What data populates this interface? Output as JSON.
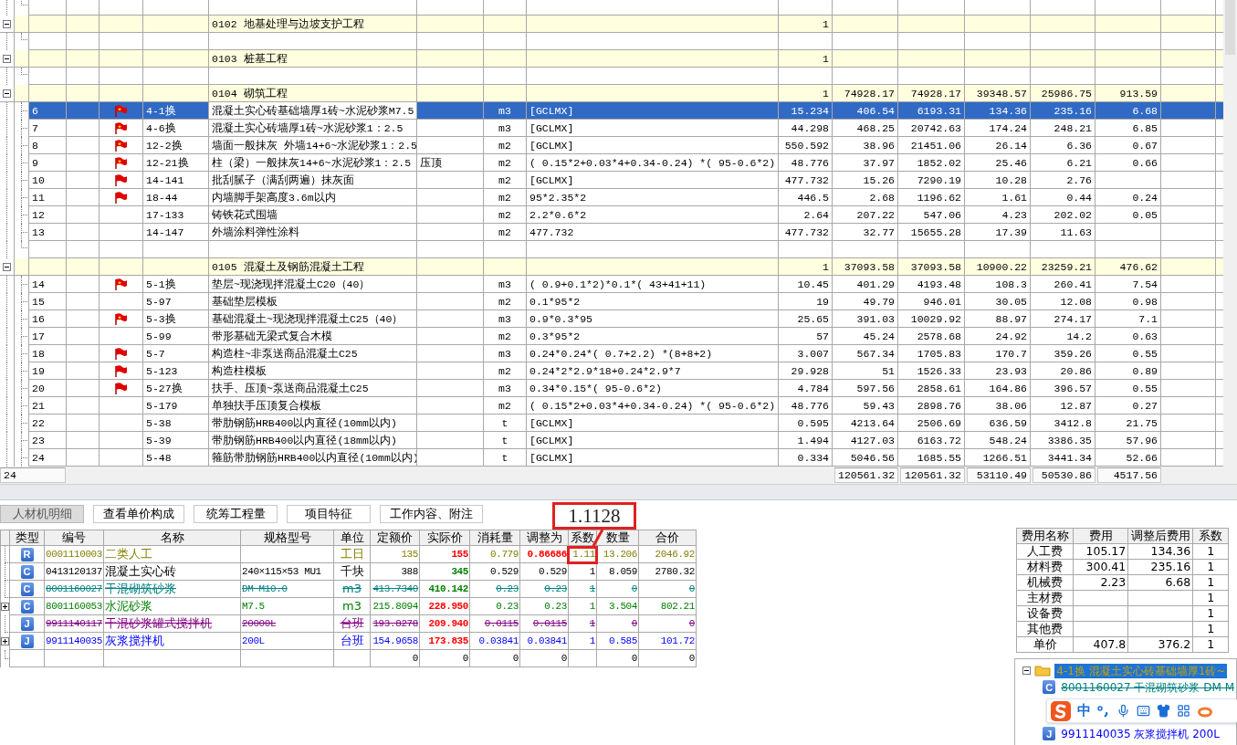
{
  "top_table": {
    "rows": [
      {
        "kind": "blank"
      },
      {
        "kind": "group",
        "expanded": true,
        "title": "0102 地基处理与边坡支护工程",
        "qty": "1"
      },
      {
        "kind": "blank"
      },
      {
        "kind": "group",
        "expanded": true,
        "title": "0103 桩基工程",
        "qty": "1"
      },
      {
        "kind": "blank"
      },
      {
        "kind": "group",
        "expanded": true,
        "title": "0104 砌筑工程",
        "qty": "1",
        "values": [
          "74928.17",
          "74928.17",
          "39348.57",
          "25986.75",
          "913.59"
        ]
      },
      {
        "kind": "item",
        "selected": true,
        "seq": "6",
        "flagged": true,
        "starred": true,
        "code": "4-1换",
        "name": "混凝土实心砖基础墙厚1砖~水泥砂浆M7.5",
        "unit": "m3",
        "formula": "[GCLMX]",
        "qty": "15.234",
        "values": [
          "406.54",
          "6193.31",
          "134.36",
          "235.16",
          "6.68"
        ]
      },
      {
        "kind": "item",
        "selected": false,
        "seq": "7",
        "flagged": true,
        "starred": true,
        "code": "4-6换",
        "name": "混凝土实心砖墙厚1砖~水泥砂浆1：2.5",
        "unit": "m3",
        "formula": "[GCLMX]",
        "qty": "44.298",
        "values": [
          "468.25",
          "20742.63",
          "174.24",
          "248.21",
          "6.85"
        ]
      },
      {
        "kind": "item",
        "selected": false,
        "seq": "8",
        "flagged": true,
        "starred": true,
        "code": "12-2换",
        "name": "墙面一般抹灰 外墙14+6~水泥砂浆1：2.5",
        "unit": "m2",
        "formula": "[GCLMX]",
        "qty": "550.592",
        "values": [
          "38.96",
          "21451.06",
          "26.14",
          "6.36",
          "0.67"
        ]
      },
      {
        "kind": "item",
        "selected": false,
        "seq": "9",
        "flagged": true,
        "starred": true,
        "code": "12-21换",
        "name": "柱（梁）一般抹灰14+6~水泥砂浆1：2.5",
        "note": "压顶",
        "unit": "m2",
        "formula": "( 0.15*2+0.03*4+0.34-0.24) *( 95-0.6*2)",
        "qty": "48.776",
        "values": [
          "37.97",
          "1852.02",
          "25.46",
          "6.21",
          "0.66"
        ]
      },
      {
        "kind": "item",
        "selected": false,
        "seq": "10",
        "flagged": true,
        "starred": false,
        "code": "14-141",
        "name": "批刮腻子（满刮两遍）抹灰面",
        "unit": "m2",
        "formula": "[GCLMX]",
        "qty": "477.732",
        "values": [
          "15.26",
          "7290.19",
          "10.28",
          "2.76"
        ]
      },
      {
        "kind": "item",
        "selected": false,
        "seq": "11",
        "flagged": true,
        "starred": false,
        "code": "18-44",
        "name": "内墙脚手架高度3.6m以内",
        "unit": "m2",
        "formula": "95*2.35*2",
        "qty": "446.5",
        "values": [
          "2.68",
          "1196.62",
          "1.61",
          "0.44",
          "0.24"
        ]
      },
      {
        "kind": "item",
        "selected": false,
        "seq": "12",
        "flagged": false,
        "code": "17-133",
        "name": "铸铁花式围墙",
        "unit": "m2",
        "formula": "2.2*0.6*2",
        "qty": "2.64",
        "values": [
          "207.22",
          "547.06",
          "4.23",
          "202.02",
          "0.05"
        ]
      },
      {
        "kind": "item",
        "selected": false,
        "seq": "13",
        "flagged": false,
        "code": "14-147",
        "name": "外墙涂料弹性涂料",
        "unit": "m2",
        "formula": "477.732",
        "qty": "477.732",
        "values": [
          "32.77",
          "15655.28",
          "17.39",
          "11.63"
        ]
      },
      {
        "kind": "blank"
      },
      {
        "kind": "group",
        "expanded": true,
        "title": "0105 混凝土及钢筋混凝土工程",
        "qty": "1",
        "values": [
          "37093.58",
          "37093.58",
          "10900.22",
          "23259.21",
          "476.62"
        ]
      },
      {
        "kind": "item",
        "selected": false,
        "seq": "14",
        "flagged": true,
        "starred": true,
        "code": "5-1换",
        "name": "垫层~现浇现拌混凝土C20（40）",
        "unit": "m3",
        "formula": "( 0.9+0.1*2)*0.1*( 43+41+11)",
        "qty": "10.45",
        "values": [
          "401.29",
          "4193.48",
          "108.3",
          "260.41",
          "7.54"
        ]
      },
      {
        "kind": "item",
        "selected": false,
        "seq": "15",
        "flagged": false,
        "code": "5-97",
        "name": "基础垫层模板",
        "unit": "m2",
        "formula": "0.1*95*2",
        "qty": "19",
        "values": [
          "49.79",
          "946.01",
          "30.05",
          "12.08",
          "0.98"
        ]
      },
      {
        "kind": "item",
        "selected": false,
        "seq": "16",
        "flagged": true,
        "starred": true,
        "code": "5-3换",
        "name": "基础混凝土~现浇现拌混凝土C25（40）",
        "unit": "m3",
        "formula": "0.9*0.3*95",
        "qty": "25.65",
        "values": [
          "391.03",
          "10029.92",
          "88.97",
          "274.17",
          "7.1"
        ]
      },
      {
        "kind": "item",
        "selected": false,
        "seq": "17",
        "flagged": false,
        "code": "5-99",
        "name": "带形基础无梁式复合木模",
        "unit": "m2",
        "formula": "0.3*95*2",
        "qty": "57",
        "values": [
          "45.24",
          "2578.68",
          "24.92",
          "14.2",
          "0.63"
        ]
      },
      {
        "kind": "item",
        "selected": false,
        "seq": "18",
        "flagged": true,
        "starred": false,
        "code": "5-7",
        "name": "构造柱~非泵送商品混凝土C25",
        "unit": "m3",
        "formula": "0.24*0.24*( 0.7+2.2) *(8+8+2)",
        "qty": "3.007",
        "values": [
          "567.34",
          "1705.83",
          "170.7",
          "359.26",
          "0.55"
        ]
      },
      {
        "kind": "item",
        "selected": false,
        "seq": "19",
        "flagged": true,
        "starred": false,
        "code": "5-123",
        "name": "构造柱模板",
        "unit": "m2",
        "formula": "0.24*2*2.9*18+0.24*2.9*7",
        "qty": "29.928",
        "values": [
          "51",
          "1526.33",
          "23.93",
          "20.86",
          "0.89"
        ]
      },
      {
        "kind": "item",
        "selected": false,
        "seq": "20",
        "flagged": true,
        "starred": false,
        "code": "5-27换",
        "name": "扶手、压顶~泵送商品混凝土C25",
        "unit": "m3",
        "formula": "0.34*0.15*( 95-0.6*2)",
        "qty": "4.784",
        "values": [
          "597.56",
          "2858.61",
          "164.86",
          "396.57",
          "0.55"
        ]
      },
      {
        "kind": "item",
        "selected": false,
        "seq": "21",
        "flagged": false,
        "code": "5-179",
        "name": "单独扶手压顶复合模板",
        "unit": "m2",
        "formula": "( 0.15*2+0.03*4+0.34-0.24) *( 95-0.6*2)",
        "qty": "48.776",
        "values": [
          "59.43",
          "2898.76",
          "38.06",
          "12.87",
          "0.27"
        ]
      },
      {
        "kind": "item",
        "selected": false,
        "seq": "22",
        "flagged": false,
        "code": "5-38",
        "name": "带肋钢筋HRB400以内直径(10mm以内)",
        "unit": "t",
        "formula": "[GCLMX]",
        "qty": "0.595",
        "values": [
          "4213.64",
          "2506.69",
          "636.59",
          "3412.8",
          "21.75"
        ]
      },
      {
        "kind": "item",
        "selected": false,
        "seq": "23",
        "flagged": false,
        "code": "5-39",
        "name": "带肋钢筋HRB400以内直径(18mm以内)",
        "unit": "t",
        "formula": "[GCLMX]",
        "qty": "1.494",
        "values": [
          "4127.03",
          "6163.72",
          "548.24",
          "3386.35",
          "57.96"
        ]
      },
      {
        "kind": "item",
        "selected": false,
        "seq": "24",
        "flagged": false,
        "code": "5-48",
        "name": "箍筋带肋钢筋HRB400以内直径(10mm以内)",
        "unit": "t",
        "formula": "[GCLMX]",
        "qty": "0.334",
        "values": [
          "5046.56",
          "1685.55",
          "1266.51",
          "3441.34",
          "52.66"
        ]
      }
    ],
    "footer": {
      "count": "24",
      "totals": [
        "120561.32",
        "120561.32",
        "53110.49",
        "50530.86",
        "4517.56"
      ]
    }
  },
  "bottom_tabs": [
    {
      "label": "人材机明细",
      "selected": true
    },
    {
      "label": "查看单价构成",
      "selected": false
    },
    {
      "label": "统筹工程量",
      "selected": false
    },
    {
      "label": "项目特征",
      "selected": false
    },
    {
      "label": "工作内容、附注",
      "selected": false
    }
  ],
  "callout": {
    "value": "1.1128"
  },
  "resource_grid": {
    "columns": [
      "类型",
      "编号",
      "名称",
      "规格型号",
      "单位",
      "定额价",
      "实际价",
      "消耗量",
      "调整为",
      "系数",
      "数量",
      "合价"
    ],
    "rows": [
      {
        "kind": "resource",
        "type": "R",
        "expandable": false,
        "color": "#808000",
        "struck": false,
        "price_up": true,
        "adjusted_highlight": true,
        "code": "0001110003",
        "name": "二类人工",
        "unit": "工日",
        "quota_price": "135",
        "actual_price": "155",
        "consumption": "0.779",
        "adjusted": "0.86686",
        "coefficient": "1.11",
        "quantity": "13.206",
        "total": "2046.92"
      },
      {
        "kind": "resource",
        "type": "C",
        "expandable": false,
        "color": "#000000",
        "struck": false,
        "price_up": false,
        "adjusted_highlight": false,
        "code": "0413120137",
        "name": "混凝土实心砖",
        "spec": "240×115×53 MU1",
        "unit": "千块",
        "quota_price": "388",
        "actual_price": "345",
        "consumption": "0.529",
        "adjusted": "0.529",
        "coefficient": "1",
        "quantity": "8.059",
        "total": "2780.32"
      },
      {
        "kind": "resource",
        "type": "C",
        "expandable": false,
        "color": "#008080",
        "struck": true,
        "price_up": false,
        "adjusted_highlight": false,
        "code": "8001160027",
        "name": "干混砌筑砂浆",
        "spec": "DM M10.0",
        "unit": "m3",
        "quota_price": "413.7340",
        "actual_price": "410.142",
        "consumption": "0.23",
        "adjusted": "0.23",
        "coefficient": "1",
        "quantity": "0",
        "total": "0"
      },
      {
        "kind": "resource",
        "type": "C",
        "expandable": true,
        "color": "#008000",
        "struck": false,
        "price_up": true,
        "adjusted_highlight": false,
        "code": "8001160053",
        "name": "水泥砂浆",
        "spec": "M7.5",
        "unit": "m3",
        "quota_price": "215.8094",
        "actual_price": "228.950",
        "consumption": "0.23",
        "adjusted": "0.23",
        "coefficient": "1",
        "quantity": "3.504",
        "total": "802.21"
      },
      {
        "kind": "resource",
        "type": "J",
        "expandable": false,
        "color": "#800080",
        "struck": true,
        "price_up": true,
        "adjusted_highlight": false,
        "code": "9911140117",
        "name": "干混砂浆罐式搅拌机",
        "spec": "20000L",
        "unit": "台班",
        "quota_price": "193.8278",
        "actual_price": "209.940",
        "consumption": "0.0115",
        "adjusted": "0.0115",
        "coefficient": "1",
        "quantity": "0",
        "total": "0"
      },
      {
        "kind": "resource",
        "type": "J",
        "expandable": true,
        "color": "#0000ff",
        "struck": false,
        "price_up": true,
        "adjusted_highlight": false,
        "code": "9911140035",
        "name": "灰浆搅拌机",
        "spec": "200L",
        "unit": "台班",
        "quota_price": "154.9658",
        "actual_price": "173.835",
        "consumption": "0.03841",
        "adjusted": "0.03841",
        "coefficient": "1",
        "quantity": "0.585",
        "total": "101.72"
      },
      {
        "kind": "sum",
        "quota_price": "0",
        "actual_price": "0",
        "consumption": "0",
        "adjusted": "0",
        "quantity": "0",
        "total": "0"
      }
    ]
  },
  "cost_table": {
    "columns": [
      "费用名称",
      "费用",
      "调整后费用",
      "系数"
    ],
    "rows": [
      {
        "name": "人工费",
        "cost": "105.17",
        "adjusted_cost": "134.36",
        "coefficient": "1"
      },
      {
        "name": "材料费",
        "cost": "300.41",
        "adjusted_cost": "235.16",
        "coefficient": "1"
      },
      {
        "name": "机械费",
        "cost": "2.23",
        "adjusted_cost": "6.68",
        "coefficient": "1"
      },
      {
        "name": "主材费",
        "coefficient": "1"
      },
      {
        "name": "设备费",
        "coefficient": "1"
      },
      {
        "name": "其他费",
        "coefficient": "1"
      },
      {
        "name": "单价",
        "cost": "407.8",
        "adjusted_cost": "376.2",
        "coefficient": "1"
      }
    ]
  },
  "resource_tree": {
    "root": {
      "label": "4-1换 混凝土实心砖基础墙厚1砖~",
      "expanded": true,
      "selected": true
    },
    "children": [
      {
        "type": "C",
        "label": "8001160027 干混砌筑砂浆 DM M",
        "color": "#008080",
        "struck": true
      },
      {
        "type": "J",
        "label": "9911140035 灰浆搅拌机 200L",
        "color": "#0000ff",
        "struck": false
      }
    ]
  },
  "ime_toolbar": {
    "mode": "中"
  }
}
